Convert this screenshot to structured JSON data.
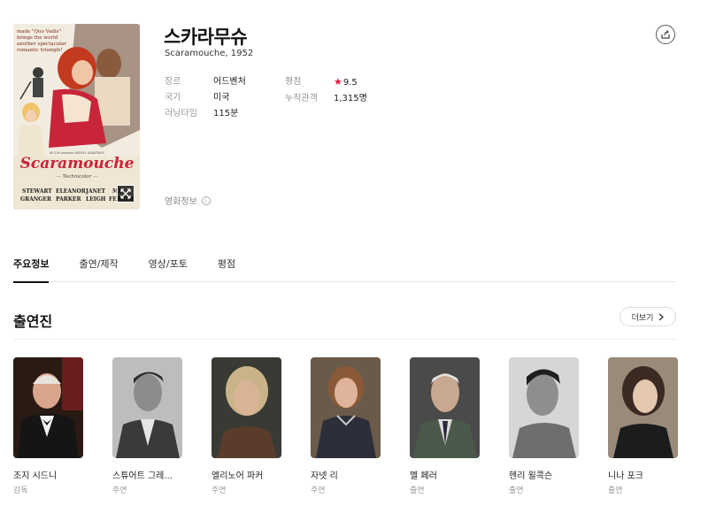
{
  "movie": {
    "title": "스카라무슈",
    "subtitle": "Scaramouche, 1952",
    "poster": {
      "tagline": "made \"Quo Vadis\" brings the world another spectacular romantic triumph!",
      "title_art": "Scaramouche",
      "technicolor": "— Technicolor —",
      "credits_line": "M-G-M presents RAFAEL SABATINI'S",
      "stars": [
        "STEWART GRANGER",
        "ELEANOR PARKER",
        "JANET LEIGH",
        "MEL FERRER"
      ]
    },
    "meta_left": [
      {
        "label": "장르",
        "value": "어드벤처"
      },
      {
        "label": "국가",
        "value": "미국"
      },
      {
        "label": "러닝타임",
        "value": "115분"
      }
    ],
    "meta_right": [
      {
        "label": "평점",
        "value": "9.5"
      },
      {
        "label": "누적관객",
        "value": "1,315명"
      }
    ],
    "movie_info_label": "영화정보",
    "info_icon": "i"
  },
  "tabs": [
    {
      "label": "주요정보",
      "active": true
    },
    {
      "label": "출연/제작",
      "active": false
    },
    {
      "label": "영상/포토",
      "active": false
    },
    {
      "label": "평점",
      "active": false
    }
  ],
  "cast_section": {
    "title": "출연진",
    "more_label": "더보기",
    "people": [
      {
        "name": "조지 시드니",
        "role": "감독"
      },
      {
        "name": "스튜어트 그레...",
        "role": "주연"
      },
      {
        "name": "엘리노어 파커",
        "role": "주연"
      },
      {
        "name": "자넷 리",
        "role": "주연"
      },
      {
        "name": "멜 페러",
        "role": "출연"
      },
      {
        "name": "헨리 윌콕슨",
        "role": "출연"
      },
      {
        "name": "니나 포크",
        "role": "출연"
      }
    ]
  },
  "colors": {
    "accent_star": "#e8163c",
    "tab_active": "#111111"
  },
  "icons": {
    "share": "share-icon",
    "expand": "expand-icon",
    "chevron": "chevron-right-icon",
    "star": "star-icon"
  }
}
